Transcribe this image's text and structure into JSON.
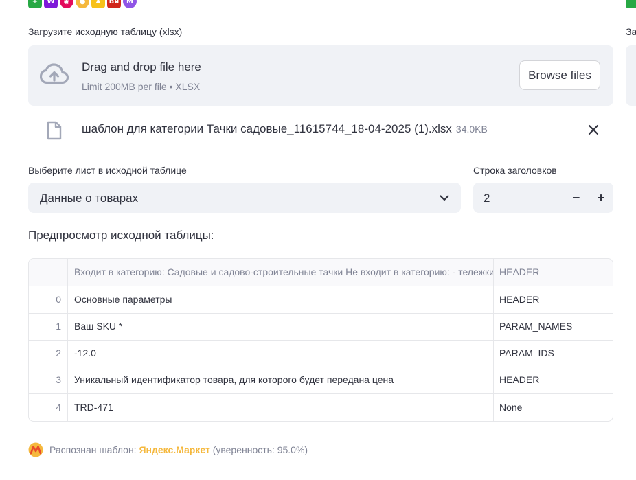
{
  "marketplace_icons": [
    {
      "name": "plus-market",
      "color": "#27a844",
      "glyph": "+"
    },
    {
      "name": "wildberries",
      "color": "#7f19d9",
      "glyph": "W"
    },
    {
      "name": "lamoda",
      "color": "#e30b5c",
      "glyph": "◉"
    },
    {
      "name": "yandex-market",
      "color": "#f5b83d",
      "glyph": "●"
    },
    {
      "name": "sber-megamarket",
      "color": "#f7c11a",
      "glyph": "♟"
    },
    {
      "name": "vi",
      "color": "#d1261b",
      "glyph": "Ви"
    },
    {
      "name": "megamarket",
      "color": "#9055e6",
      "glyph": "M"
    }
  ],
  "upload": {
    "label": "Загрузите исходную таблицу (xlsx)",
    "drop_title": "Drag and drop file here",
    "drop_sub": "Limit 200MB per file • XLSX",
    "browse_label": "Browse files"
  },
  "file": {
    "name": "шаблон для категории Тачки садовые_11615744_18-04-2025 (1).xlsx",
    "size": "34.0KB"
  },
  "sheet_select": {
    "label": "Выберите лист в исходной таблице",
    "value": "Данные о товарах"
  },
  "header_row": {
    "label": "Строка заголовков",
    "value": "2",
    "minus": "−",
    "plus": "+"
  },
  "preview": {
    "title": "Предпросмотр исходной таблицы:",
    "columns": [
      "",
      "Входит в категорию: Садовые и садово-строительные тачки  Не входит в категорию: - тележки",
      "HEADER"
    ],
    "rows": [
      [
        "0",
        "Основные параметры",
        "HEADER"
      ],
      [
        "1",
        "Ваш SKU *",
        "PARAM_NAMES"
      ],
      [
        "2",
        "-12.0",
        "PARAM_IDS"
      ],
      [
        "3",
        "Уникальный идентификатор товара, для которого будет передана цена",
        "HEADER"
      ],
      [
        "4",
        "TRD-471",
        "None"
      ]
    ]
  },
  "status": {
    "prefix": "Распознан шаблон: ",
    "template": "Яндекс.Маркет",
    "suffix": " (уверенность: 95.0%)"
  },
  "right_panel": {
    "label": "За"
  }
}
